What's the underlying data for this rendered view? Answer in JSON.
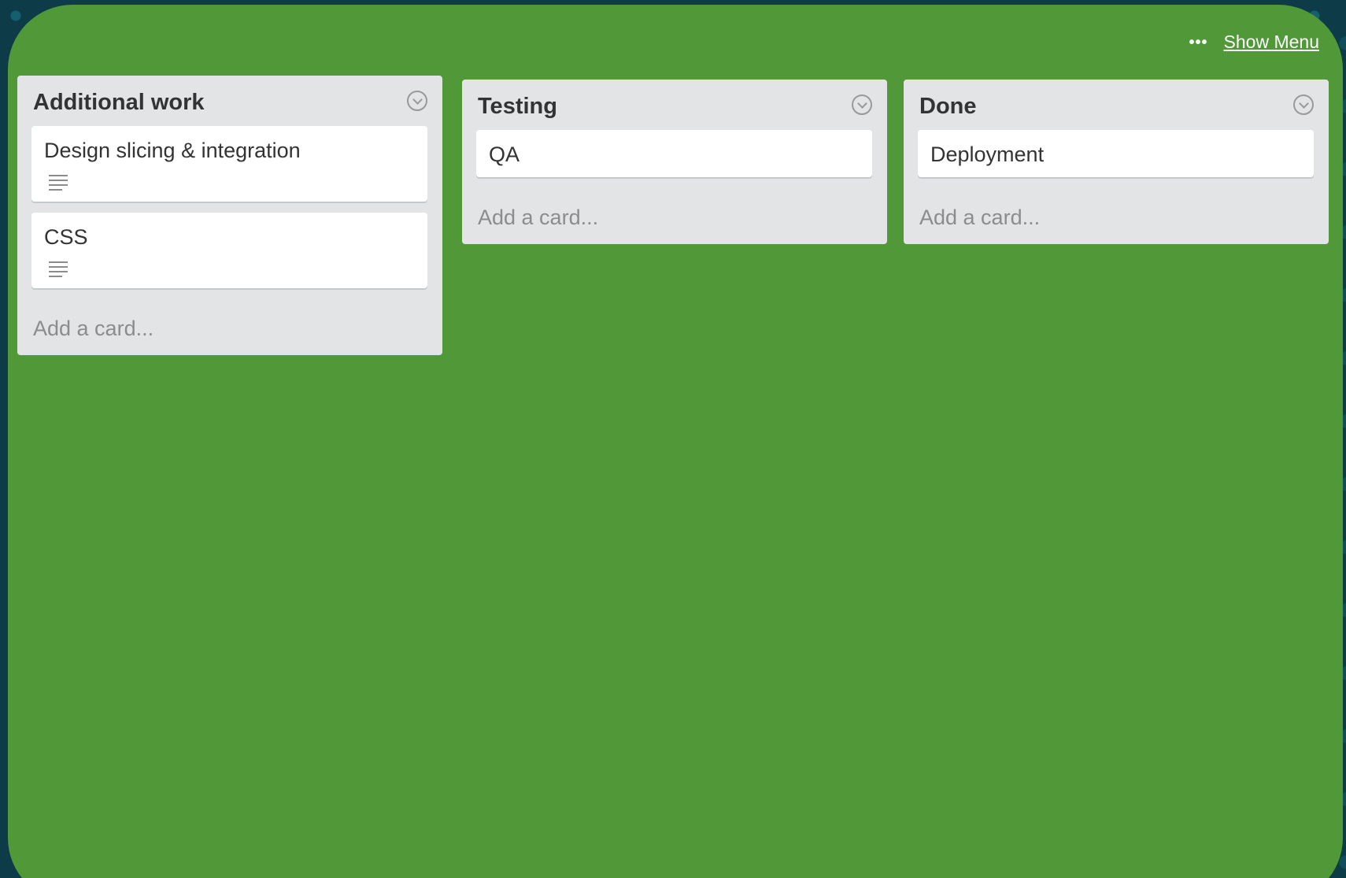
{
  "header": {
    "more_icon": "more-horizontal-icon",
    "show_menu_label": "Show Menu"
  },
  "lists": [
    {
      "title": "Additional work",
      "cards": [
        {
          "title": "Design slicing & integration",
          "has_description": true
        },
        {
          "title": "CSS",
          "has_description": true
        }
      ],
      "add_card_label": "Add a card..."
    },
    {
      "title": "Testing",
      "cards": [
        {
          "title": "QA",
          "has_description": false
        }
      ],
      "add_card_label": "Add a card..."
    },
    {
      "title": "Done",
      "cards": [
        {
          "title": "Deployment",
          "has_description": false
        }
      ],
      "add_card_label": "Add a card..."
    }
  ],
  "colors": {
    "board_background": "#519839",
    "list_background": "#e2e4e6",
    "card_background": "#ffffff"
  }
}
